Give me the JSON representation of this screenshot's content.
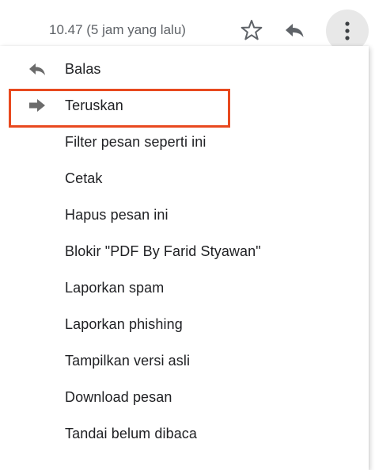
{
  "header": {
    "timestamp": "10.47 (5 jam yang lalu)",
    "star_icon": "star-outline-icon",
    "reply_icon": "reply-icon",
    "more_icon": "more-vertical-icon"
  },
  "menu": {
    "items": [
      {
        "label": "Balas",
        "icon": "reply-icon"
      },
      {
        "label": "Teruskan",
        "icon": "forward-icon",
        "highlighted": true
      },
      {
        "label": "Filter pesan seperti ini"
      },
      {
        "label": "Cetak"
      },
      {
        "label": "Hapus pesan ini"
      },
      {
        "label": "Blokir \"PDF By Farid Styawan\""
      },
      {
        "label": "Laporkan spam"
      },
      {
        "label": "Laporkan phishing"
      },
      {
        "label": "Tampilkan versi asli"
      },
      {
        "label": "Download pesan"
      },
      {
        "label": "Tandai belum dibaca"
      }
    ]
  },
  "colors": {
    "highlight_border": "#e8491f",
    "text": "#202124",
    "muted_text": "#5f6368",
    "icon": "#6b6b6b"
  }
}
